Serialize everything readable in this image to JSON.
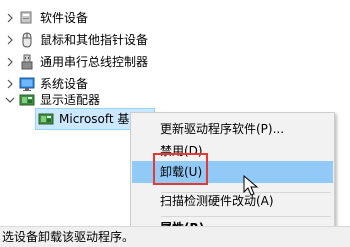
{
  "tree": {
    "categories": [
      {
        "label": "软件设备",
        "expanded": false,
        "icon": "software-device-icon"
      },
      {
        "label": "鼠标和其他指针设备",
        "expanded": false,
        "icon": "mouse-icon"
      },
      {
        "label": "通用串行总线控制器",
        "expanded": false,
        "icon": "usb-controller-icon"
      },
      {
        "label": "系统设备",
        "expanded": false,
        "icon": "system-device-icon"
      },
      {
        "label": "显示适配器",
        "expanded": true,
        "icon": "display-adapter-icon"
      }
    ],
    "selected_child": {
      "label": "Microsoft 基",
      "icon": "display-adapter-icon"
    }
  },
  "context_menu": {
    "items": [
      {
        "label": "更新驱动程序软件(P)..."
      },
      {
        "label": "禁用(D)"
      },
      {
        "label": "卸载(U)",
        "highlighted": true
      },
      {
        "label": "扫描检测硬件改动(A)"
      },
      {
        "label": "属性(R)",
        "bold": true
      }
    ]
  },
  "status_bar": {
    "text": "选设备卸载该驱动程序。"
  },
  "colors": {
    "highlight": "#91c9f7",
    "annotation_box": "#e53935",
    "selection": "#cce8ff"
  }
}
